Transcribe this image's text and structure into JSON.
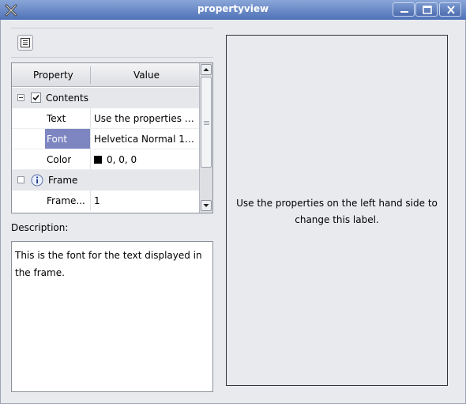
{
  "window": {
    "title": "propertyview",
    "icon": "x-app-icon"
  },
  "window_controls": {
    "minimize": "minimize-icon",
    "maximize": "maximize-icon",
    "close": "close-icon"
  },
  "toolbar": {
    "icon": "list-icon"
  },
  "property_tree": {
    "columns": [
      "Property",
      "Value"
    ],
    "rows": [
      {
        "type": "group",
        "label": "Contents",
        "expanded": true,
        "checkbox": true
      },
      {
        "type": "item",
        "label": "Text",
        "value": "Use the properties o..."
      },
      {
        "type": "item",
        "label": "Font",
        "value": "Helvetica Normal 10...",
        "selected": true
      },
      {
        "type": "item",
        "label": "Color",
        "value": "0, 0, 0",
        "swatch": "#000000"
      },
      {
        "type": "group",
        "label": "Frame",
        "expanded": false,
        "icon": "info-icon"
      },
      {
        "type": "item",
        "label": "Frame...",
        "value": "1"
      }
    ]
  },
  "description": {
    "label": "Description:",
    "text": "This is the font for the text displayed in the frame."
  },
  "preview": {
    "text": "Use the properties on the left hand side to change this label."
  }
}
